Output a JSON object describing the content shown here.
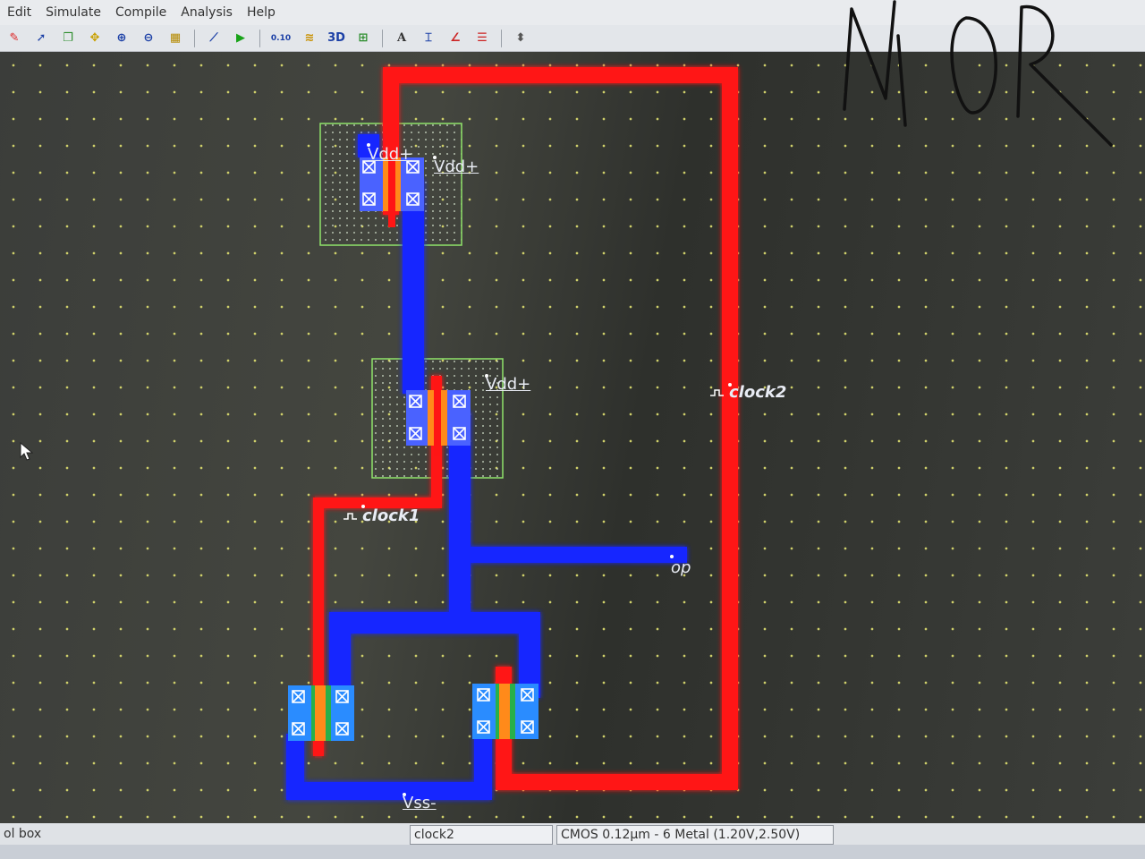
{
  "menu": [
    "Edit",
    "Simulate",
    "Compile",
    "Analysis",
    "Help"
  ],
  "toolbar": {
    "icons": [
      "pencil-icon",
      "select-icon",
      "copy-icon",
      "move-icon",
      "zoom-in-icon",
      "zoom-out-icon",
      "fit-icon",
      "measure-icon",
      "run-icon",
      "scale-icon",
      "ruler-icon",
      "3d-view-icon",
      "chip-icon",
      "text-icon",
      "align-icon",
      "curve-icon",
      "palette-icon",
      "arrows-icon"
    ],
    "scale_label": "0.10",
    "view3d_label": "3D",
    "text_label": "A"
  },
  "layout": {
    "labels": {
      "vdd_1": "Vdd+",
      "vdd_2": "Vdd+",
      "vdd_3": "Vdd+",
      "clock1": "clock1",
      "clock2": "clock2",
      "op": "op",
      "vss": "Vss-"
    },
    "handwritten": "NOR"
  },
  "statusbar": {
    "left": "ol box",
    "middle": "clock2",
    "technology": "CMOS 0.12µm - 6 Metal (1.20V,2.50V)"
  },
  "colors": {
    "metal": "#1020ff",
    "poly": "#ff1010",
    "nwell": "#8fe36a",
    "diffusion": "#3d7cff",
    "gate": "#ff8a1a"
  }
}
